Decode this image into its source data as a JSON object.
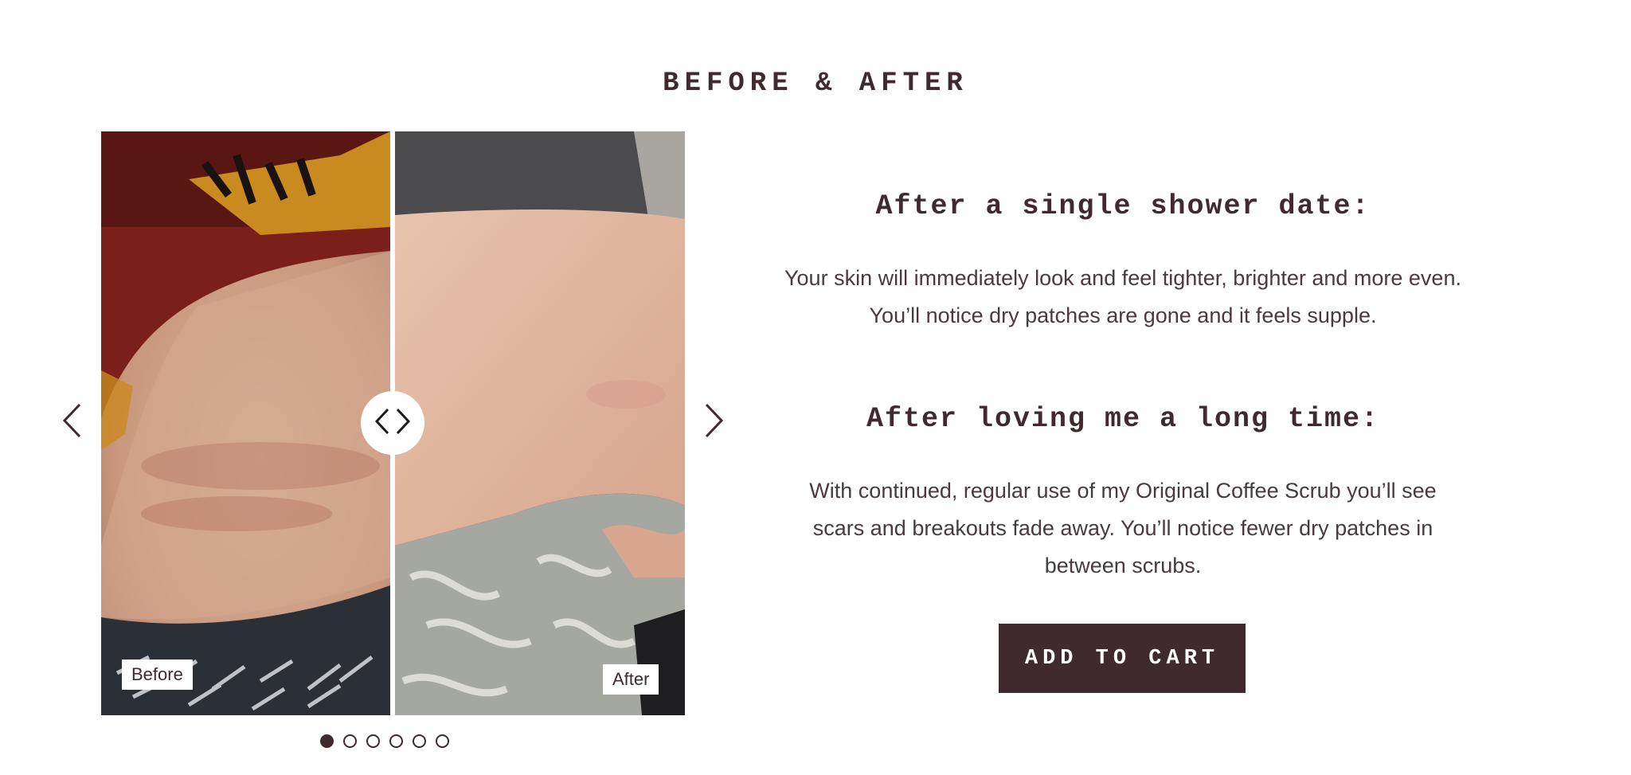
{
  "section": {
    "title": "BEFORE & AFTER"
  },
  "slider": {
    "before_label": "Before",
    "after_label": "After",
    "handle_icons": [
      "chevron-left-icon",
      "chevron-right-icon"
    ],
    "prev_icon": "chevron-left-icon",
    "next_icon": "chevron-right-icon",
    "slide_count": 6,
    "active_slide": 1
  },
  "content": {
    "heading_1": "After a single shower date:",
    "paragraph_1": "Your skin will immediately look and feel tighter, brighter and more even.\nYou’ll notice dry patches are gone and it feels supple.",
    "heading_2": "After loving me a long time:",
    "paragraph_2": "With continued, regular use of my Original Coffee Scrub you’ll see\nscars and breakouts fade away. You’ll notice fewer dry patches in\nbetween scrubs."
  },
  "cart": {
    "button_label": "ADD TO CART"
  },
  "colors": {
    "brand": "#3e2a2f",
    "background": "#ffffff"
  }
}
